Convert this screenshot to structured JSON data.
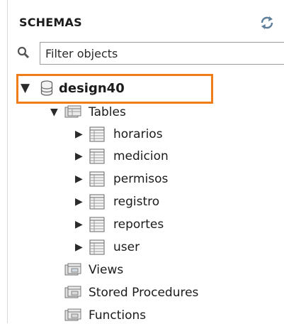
{
  "panel": {
    "title": "SCHEMAS",
    "refresh_icon": "refresh-icon",
    "search_icon": "search-icon",
    "filter_placeholder": "Filter objects"
  },
  "tree": {
    "database": {
      "name": "design40",
      "expanded": true,
      "icon": "database-icon"
    },
    "tables_group": {
      "label": "Tables",
      "expanded": true,
      "icon": "tables-folder-icon"
    },
    "tables": [
      {
        "name": "horarios",
        "icon": "table-icon"
      },
      {
        "name": "medicion",
        "icon": "table-icon"
      },
      {
        "name": "permisos",
        "icon": "table-icon"
      },
      {
        "name": "registro",
        "icon": "table-icon"
      },
      {
        "name": "reportes",
        "icon": "table-icon"
      },
      {
        "name": "user",
        "icon": "table-icon"
      }
    ],
    "other_groups": [
      {
        "label": "Views",
        "icon": "views-folder-icon"
      },
      {
        "label": "Stored Procedures",
        "icon": "procedures-folder-icon"
      },
      {
        "label": "Functions",
        "icon": "functions-folder-icon"
      }
    ]
  },
  "colors": {
    "highlight": "#f07d17",
    "text": "#1b1b1b"
  }
}
